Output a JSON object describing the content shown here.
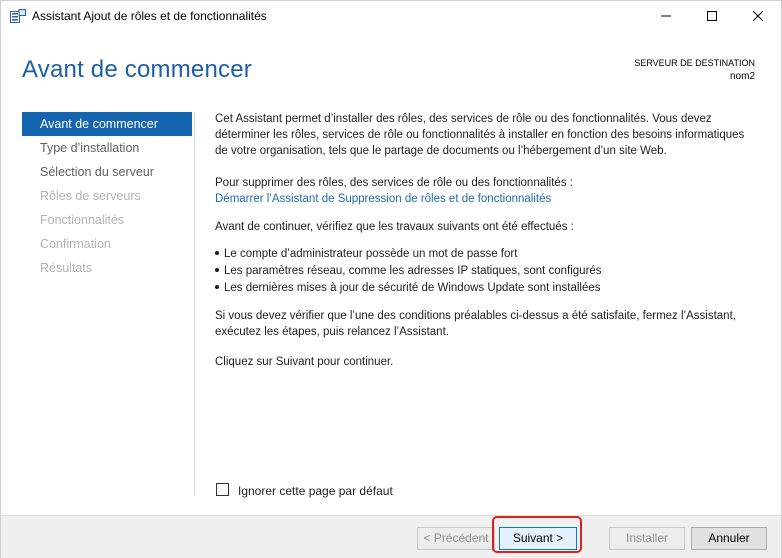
{
  "window": {
    "title": "Assistant Ajout de rôles et de fonctionnalités"
  },
  "header": {
    "page_title": "Avant de commencer",
    "destination_label": "SERVEUR DE DESTINATION",
    "destination_value": "nom2"
  },
  "nav": {
    "items": [
      {
        "label": "Avant de commencer",
        "state": "active"
      },
      {
        "label": "Type d’installation",
        "state": "enabled"
      },
      {
        "label": "Sélection du serveur",
        "state": "enabled"
      },
      {
        "label": "Rôles de serveurs",
        "state": "disabled"
      },
      {
        "label": "Fonctionnalités",
        "state": "disabled"
      },
      {
        "label": "Confirmation",
        "state": "disabled"
      },
      {
        "label": "Résultats",
        "state": "disabled"
      }
    ]
  },
  "content": {
    "intro": "Cet Assistant permet d’installer des rôles, des services de rôle ou des fonctionnalités. Vous devez déterminer les rôles, services de rôle ou fonctionnalités à installer en fonction des besoins informatiques de votre organisation, tels que le partage de documents ou l’hébergement d’un site Web.",
    "remove_text": "Pour supprimer des rôles, des services de rôle ou des fonctionnalités :",
    "remove_link": "Démarrer l’Assistant de Suppression de rôles et de fonctionnalités",
    "before_text": "Avant de continuer, vérifiez que les travaux suivants ont été effectués :",
    "bullets": [
      "Le compte d’administrateur possède un mot de passe fort",
      "Les paramètres réseau, comme les adresses IP statiques, sont configurés",
      "Les dernières mises à jour de sécurité de Windows Update sont installées"
    ],
    "verify_text": "Si vous devez vérifier que l’une des conditions préalables ci-dessus a été satisfaite, fermez l’Assistant, exécutez les étapes, puis relancez l’Assistant.",
    "continue_text": "Cliquez sur Suivant pour continuer."
  },
  "checkbox": {
    "label": "Ignorer cette page par défaut",
    "checked": false
  },
  "footer": {
    "previous": "< Précédent",
    "next": "Suivant >",
    "install": "Installer",
    "cancel": "Annuler"
  },
  "colors": {
    "accent": "#1564b0",
    "title": "#1a5fa8",
    "link": "#1f6cb0",
    "highlight": "#e02020"
  }
}
